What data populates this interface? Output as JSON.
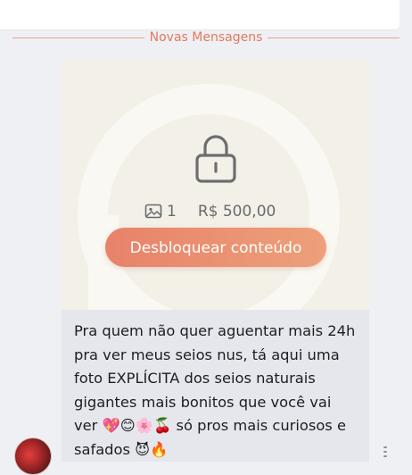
{
  "divider": {
    "label": "Novas Mensagens"
  },
  "locked_media": {
    "icon": "lock-icon",
    "media_icon": "image-icon",
    "media_count": "1",
    "price": "R$ 500,00",
    "unlock_label": "Desbloquear conteúdo"
  },
  "message": {
    "text": "Pra quem não quer aguentar mais 24h pra ver meus seios nus, tá aqui uma foto EXPLÍCITA dos seios naturais gigantes mais bonitos que você vai ver 💖😊🌸🍒 só pros mais curiosos e safados 😈🔥"
  },
  "colors": {
    "accent": "#e07a5f",
    "button_gradient_start": "#e8826a",
    "button_gradient_end": "#eda07a",
    "card_bg": "#f3f0e8",
    "bubble_bg": "#e6e7ec"
  }
}
